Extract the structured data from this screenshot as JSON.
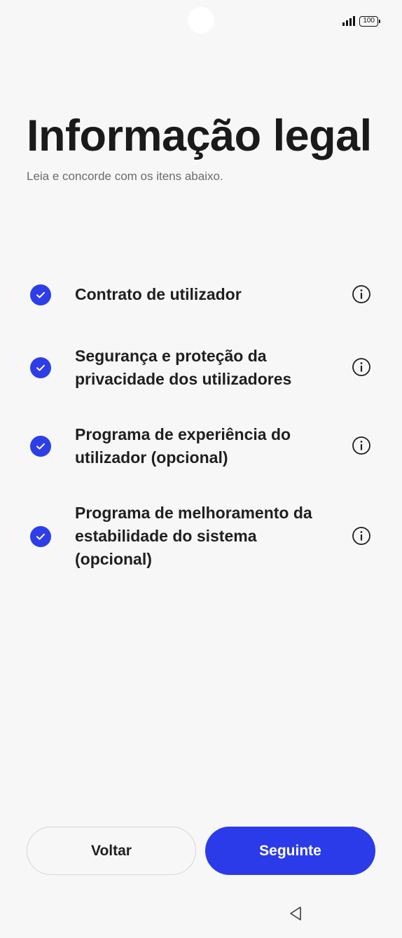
{
  "status_bar": {
    "battery_level": "100",
    "signal_icon": "signal-bars-icon"
  },
  "header": {
    "title": "Informação legal",
    "subtitle": "Leia e concorde com os itens abaixo."
  },
  "items": [
    {
      "label": "Contrato de utilizador",
      "checked": true
    },
    {
      "label": "Segurança e proteção da privacidade dos utilizadores",
      "checked": true
    },
    {
      "label": "Programa de experiência do utilizador (opcional)",
      "checked": true
    },
    {
      "label": "Programa de melhoramento da estabilidade do sistema (opcional)",
      "checked": true
    }
  ],
  "footer": {
    "back_label": "Voltar",
    "next_label": "Seguinte"
  },
  "colors": {
    "accent": "#2b3bea",
    "background": "#f7f7f7",
    "text": "#1f1f1f",
    "subtext": "#6b6b6b"
  }
}
